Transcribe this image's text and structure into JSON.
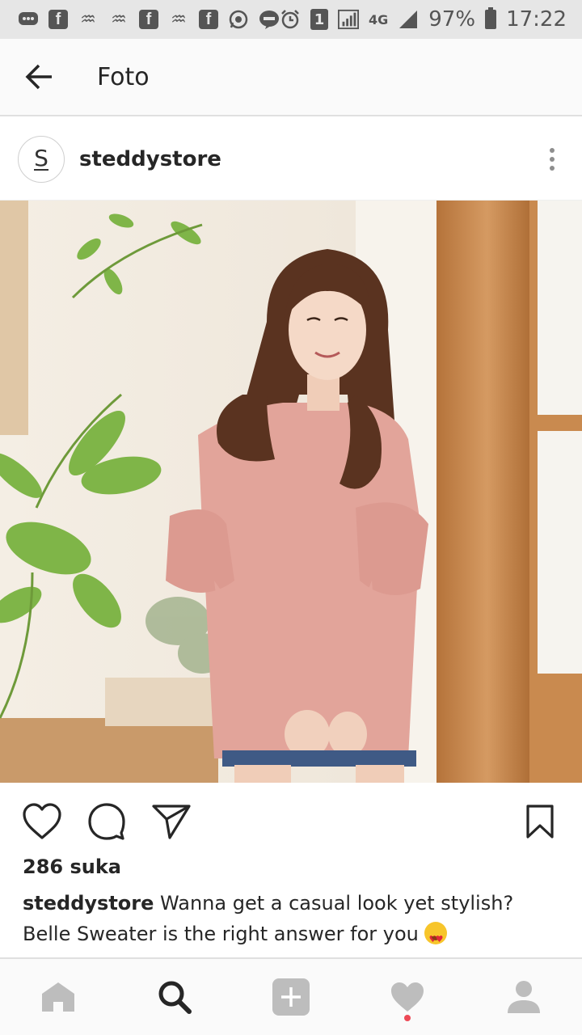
{
  "status_bar": {
    "notification_icons": [
      "message-icon",
      "facebook-icon",
      "uc-browser-icon",
      "uc-browser-icon",
      "facebook-icon",
      "uc-browser-icon",
      "facebook-icon",
      "whatsapp-icon",
      "line-icon"
    ],
    "sim_badge": "1",
    "network": "4G",
    "battery": "97%",
    "time": "17:22"
  },
  "header": {
    "title": "Foto"
  },
  "post": {
    "username": "steddystore",
    "avatar_letter": "S",
    "likes": "286 suka",
    "caption_user": "steddystore",
    "caption_text": "Wanna get a casual look yet stylish? Belle Sweater is the right answer for you"
  },
  "colors": {
    "notification_dot": "#ed4956",
    "icon_gray": "#bdbdbd",
    "text": "#262626"
  }
}
